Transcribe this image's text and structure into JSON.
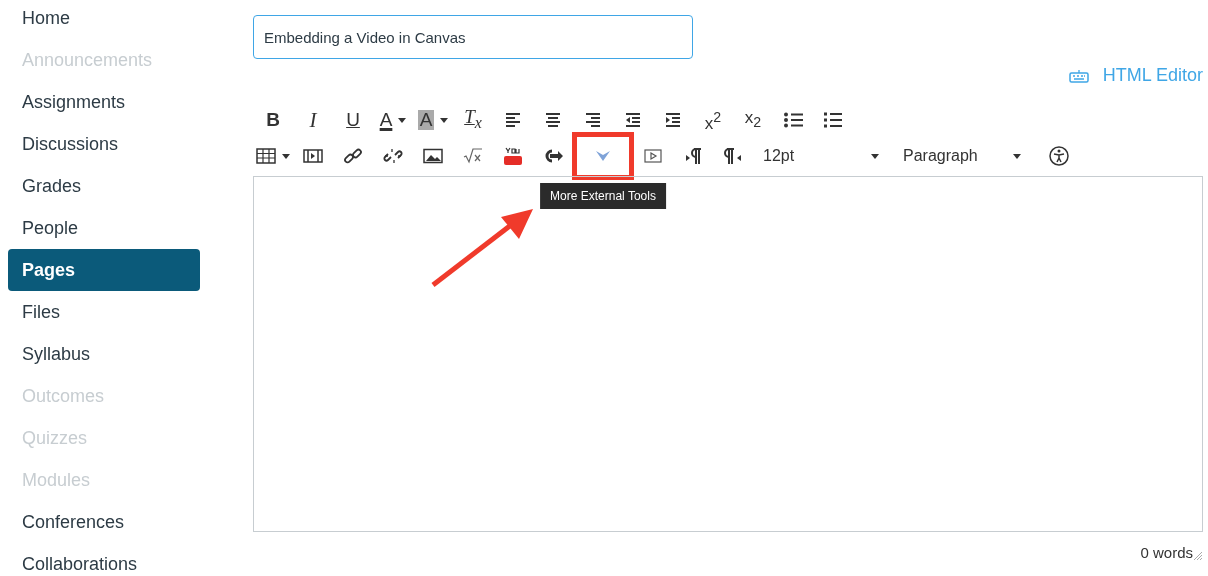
{
  "sidebar": {
    "items": [
      {
        "label": "Home",
        "disabled": false,
        "selected": false
      },
      {
        "label": "Announcements",
        "disabled": true,
        "selected": false
      },
      {
        "label": "Assignments",
        "disabled": false,
        "selected": false
      },
      {
        "label": "Discussions",
        "disabled": false,
        "selected": false
      },
      {
        "label": "Grades",
        "disabled": false,
        "selected": false
      },
      {
        "label": "People",
        "disabled": false,
        "selected": false
      },
      {
        "label": "Pages",
        "disabled": false,
        "selected": true
      },
      {
        "label": "Files",
        "disabled": false,
        "selected": false
      },
      {
        "label": "Syllabus",
        "disabled": false,
        "selected": false
      },
      {
        "label": "Outcomes",
        "disabled": true,
        "selected": false
      },
      {
        "label": "Quizzes",
        "disabled": true,
        "selected": false
      },
      {
        "label": "Modules",
        "disabled": true,
        "selected": false
      },
      {
        "label": "Conferences",
        "disabled": false,
        "selected": false
      },
      {
        "label": "Collaborations",
        "disabled": false,
        "selected": false
      }
    ]
  },
  "title_field": {
    "value": "Embedding a Video in Canvas"
  },
  "html_editor_link": "HTML Editor",
  "toolbar": {
    "rows": [
      [
        {
          "kind": "bold",
          "label": "B"
        },
        {
          "kind": "italic",
          "label": "I"
        },
        {
          "kind": "underline",
          "label": "U"
        },
        {
          "kind": "text-color",
          "label": "A"
        },
        {
          "kind": "bg-color",
          "label": "A"
        },
        {
          "kind": "clear-format",
          "label": "T$_{x}$"
        },
        {
          "kind": "align-left"
        },
        {
          "kind": "align-center"
        },
        {
          "kind": "align-right"
        },
        {
          "kind": "outdent"
        },
        {
          "kind": "indent"
        },
        {
          "kind": "superscript",
          "label": "x$^{2}$"
        },
        {
          "kind": "subscript",
          "label": "x$_{2}$"
        },
        {
          "kind": "bullets"
        },
        {
          "kind": "numbers"
        }
      ],
      [
        {
          "kind": "table"
        },
        {
          "kind": "media"
        },
        {
          "kind": "link"
        },
        {
          "kind": "unlink"
        },
        {
          "kind": "image"
        },
        {
          "kind": "math"
        },
        {
          "kind": "youtube"
        },
        {
          "kind": "embed"
        },
        {
          "kind": "external-tools",
          "highlighted": true,
          "tooltip": "More External Tools"
        },
        {
          "kind": "media-player"
        },
        {
          "kind": "ltr"
        },
        {
          "kind": "rtl"
        },
        {
          "kind": "dropdown",
          "label": "12pt"
        },
        {
          "kind": "dropdown",
          "label": "Paragraph"
        },
        {
          "kind": "accessibility"
        }
      ]
    ]
  },
  "word_count": "0 words"
}
